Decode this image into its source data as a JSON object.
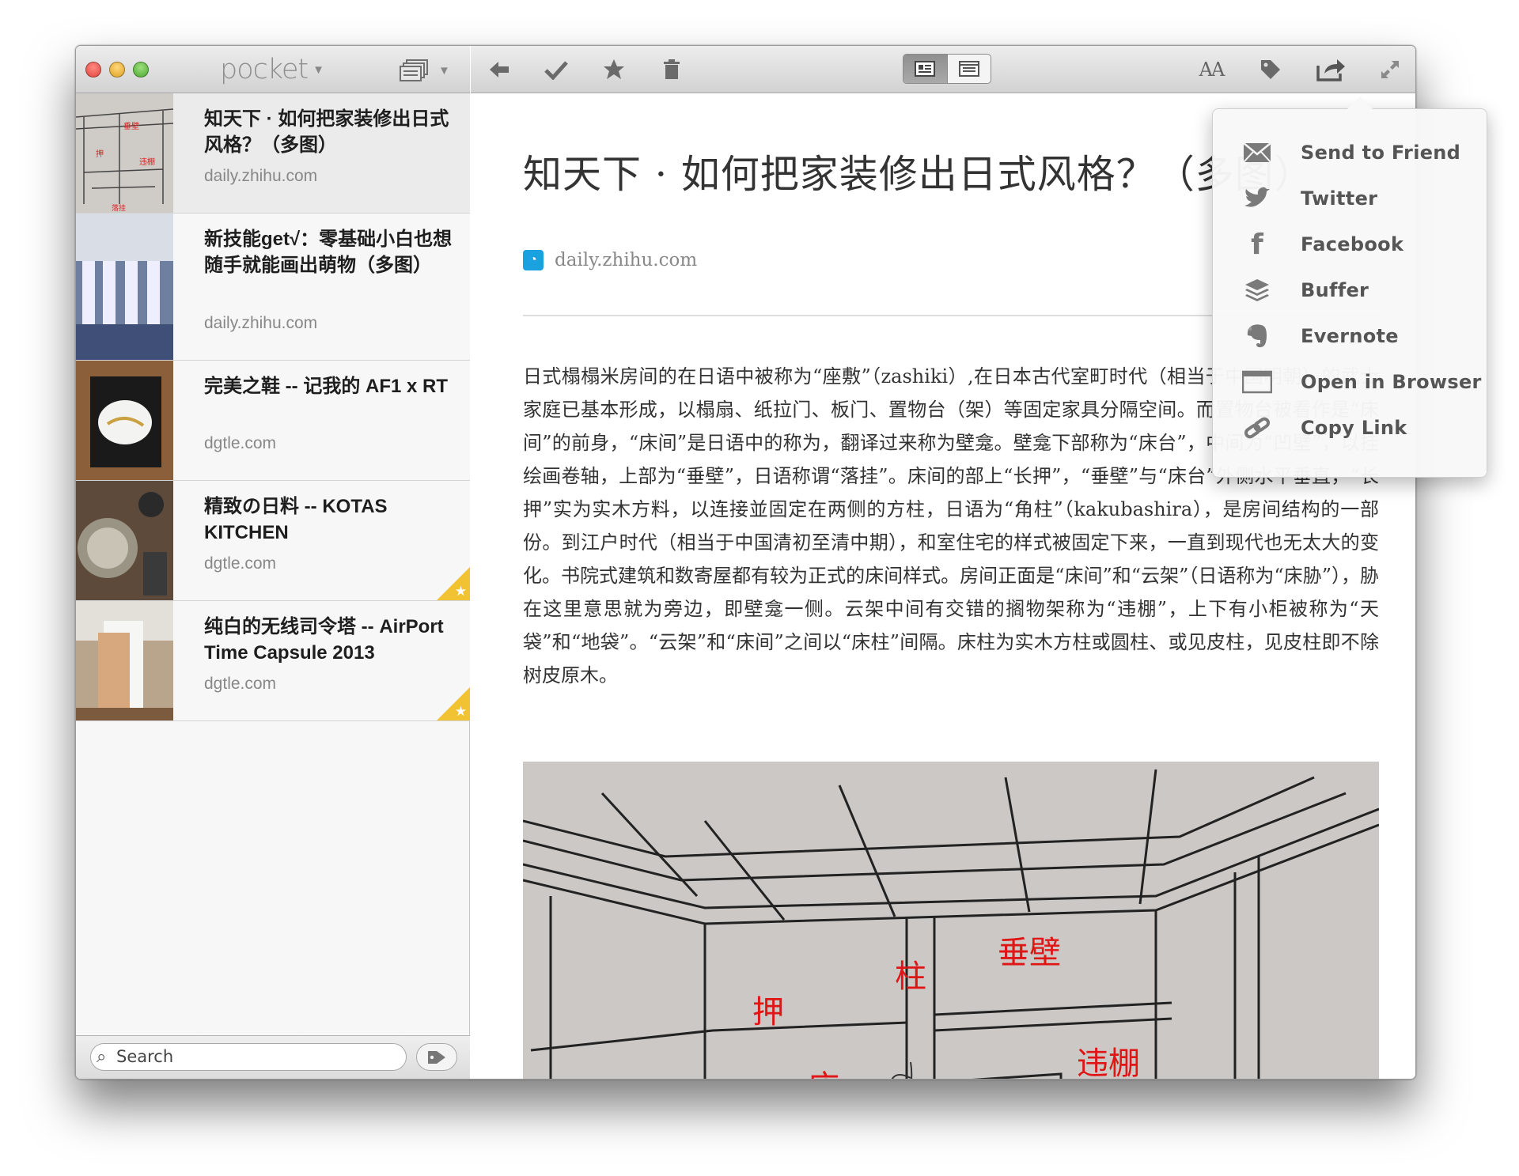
{
  "app": {
    "name": "pocket"
  },
  "sidebar": {
    "items": [
      {
        "title": "知天下 · 如何把家装修出日式风格？（多图）",
        "domain": "daily.zhihu.com",
        "favorite": false,
        "selected": true
      },
      {
        "title": "新技能get√：零基础小白也想随手就能画出萌物（多图）",
        "domain": "daily.zhihu.com",
        "favorite": false,
        "selected": false
      },
      {
        "title": "完美之鞋 -- 记我的 AF1 x RT",
        "domain": "dgtle.com",
        "favorite": false,
        "selected": false
      },
      {
        "title": "精致の日料 -- KOTAS KITCHEN",
        "domain": "dgtle.com",
        "favorite": true,
        "selected": false
      },
      {
        "title": "纯白的无线司令塔 -- AirPort Time Capsule 2013",
        "domain": "dgtle.com",
        "favorite": true,
        "selected": false
      }
    ],
    "search": {
      "placeholder": "Search"
    }
  },
  "toolbar": {
    "icons": [
      "back-arrow-icon",
      "checkmark-icon",
      "star-icon",
      "trash-icon",
      "article-view-icon",
      "web-view-icon",
      "font-size-icon",
      "tag-icon",
      "share-icon",
      "fullscreen-icon"
    ],
    "font_label": "AA"
  },
  "article": {
    "title": "知天下 · 如何把家装修出日式风格？（多图）",
    "source": "daily.zhihu.com",
    "body": "日式榻榻米房间的在日语中被称为“座敷”（zashiki）,在日本古代室町时代（相当于中国明朝）的武士家庭已基本形成，以榻扇、纸拉门、板门、置物台（架）等固定家具分隔空间。而置物台被看作是“床间”的前身，“床间”是日语中的称为，翻译过来称为壁龛。壁龛下部称为“床台”，中间为“凹壁”，以挂绘画卷轴，上部为“垂壁”，日语称谓“落挂”。床间的部上“长押”，“垂壁”与“床台”外侧水平垂直，“长押”实为实木方料，以连接並固定在两侧的方柱，日语为“角柱”（kakubashira），是房间结构的一部份。到江户时代（相当于中国清初至清中期），和室住宅的样式被固定下来，一直到现代也无太大的变化。书院式建筑和数寄屋都有较为正式的床间样式。房间正面是“床间”和“云架”（日语称为“床胁”），胁在这里意思就为旁边，即壁龛一侧。云架中间有交错的搁物架称为“违棚”，上下有小柜被称为“天袋”和“地袋”。“云架”和“床间”之间以“床柱”间隔。床柱为实木方柱或圆柱、或见皮柱，见皮柱即不除树皮原木。",
    "figure_labels": [
      "垂壁",
      "柱",
      "押",
      "床",
      "违棚"
    ]
  },
  "share_menu": {
    "items": [
      {
        "label": "Send to Friend",
        "icon": "envelope-icon"
      },
      {
        "label": "Twitter",
        "icon": "twitter-bird-icon"
      },
      {
        "label": "Facebook",
        "icon": "facebook-f-icon"
      },
      {
        "label": "Buffer",
        "icon": "buffer-stack-icon"
      },
      {
        "label": "Evernote",
        "icon": "evernote-elephant-icon"
      },
      {
        "label": "Open in Browser",
        "icon": "browser-window-icon"
      },
      {
        "label": "Copy Link",
        "icon": "link-icon"
      }
    ]
  }
}
